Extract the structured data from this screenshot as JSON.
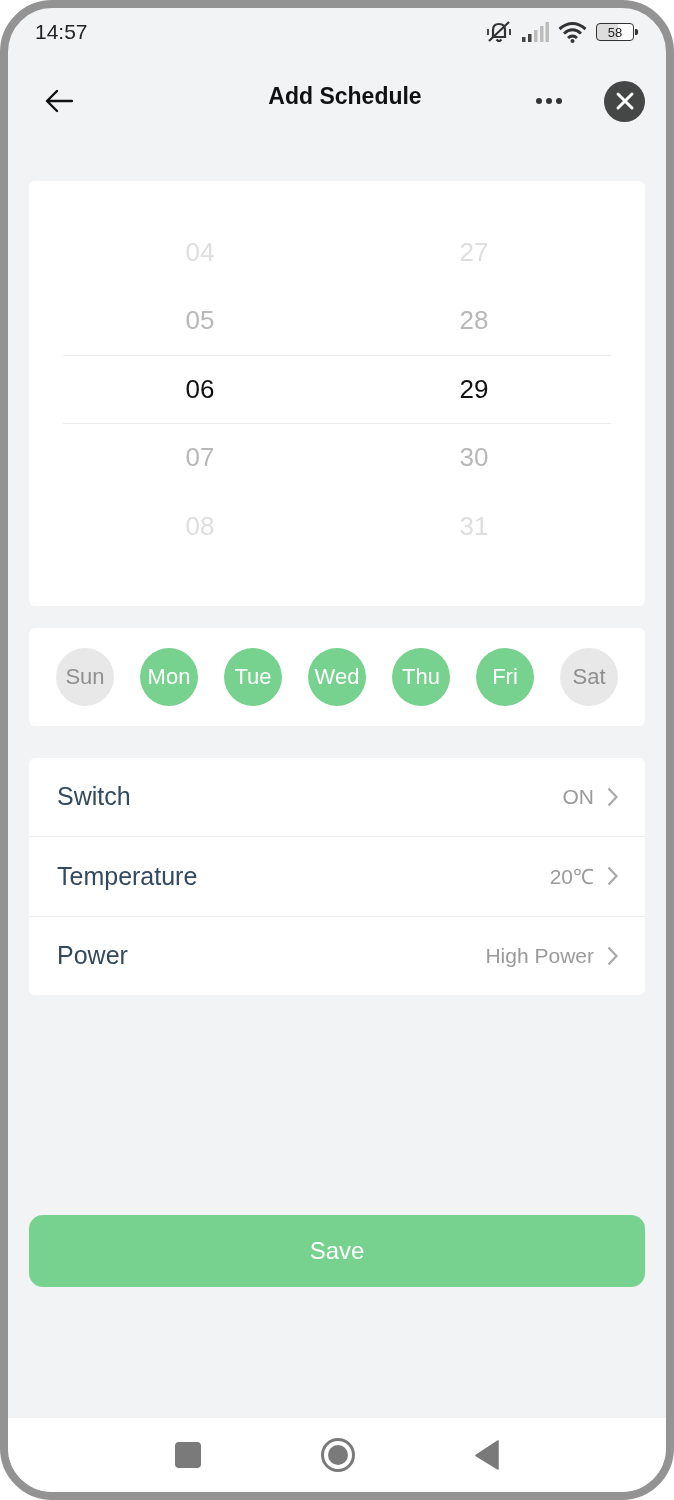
{
  "status_bar": {
    "time": "14:57",
    "battery": "58"
  },
  "header": {
    "title": "Add Schedule"
  },
  "time_picker": {
    "columns": [
      {
        "items": [
          {
            "label": "04",
            "selected": false
          },
          {
            "label": "05",
            "selected": false
          },
          {
            "label": "06",
            "selected": true
          },
          {
            "label": "07",
            "selected": false
          },
          {
            "label": "08",
            "selected": false
          }
        ]
      },
      {
        "items": [
          {
            "label": "27",
            "selected": false
          },
          {
            "label": "28",
            "selected": false
          },
          {
            "label": "29",
            "selected": true
          },
          {
            "label": "30",
            "selected": false
          },
          {
            "label": "31",
            "selected": false
          }
        ]
      }
    ]
  },
  "days": [
    {
      "label": "Sun",
      "selected": false
    },
    {
      "label": "Mon",
      "selected": true
    },
    {
      "label": "Tue",
      "selected": true
    },
    {
      "label": "Wed",
      "selected": true
    },
    {
      "label": "Thu",
      "selected": true
    },
    {
      "label": "Fri",
      "selected": true
    },
    {
      "label": "Sat",
      "selected": false
    }
  ],
  "settings": [
    {
      "label": "Switch",
      "value": "ON"
    },
    {
      "label": "Temperature",
      "value": "20℃"
    },
    {
      "label": "Power",
      "value": "High Power"
    }
  ],
  "save_button": {
    "label": "Save"
  }
}
